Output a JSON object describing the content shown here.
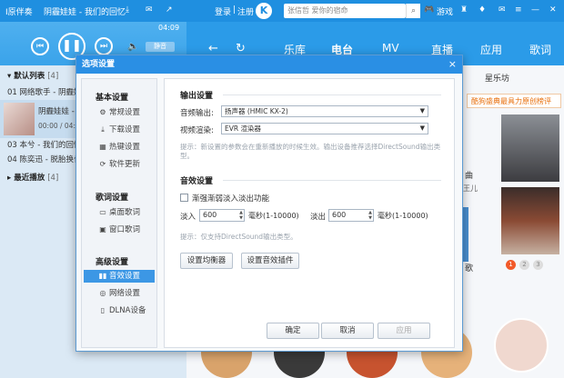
{
  "topbar": {
    "left_title": "I原伴奏",
    "now_playing": "阴霾娃娃 - 我们的回忆",
    "login": "登录",
    "separator": "|",
    "register": "注册",
    "logo_letter": "K",
    "search_placeholder": "张信哲  爱你的宿命",
    "game": "游戏",
    "time": "04:09"
  },
  "player": {
    "volume_label": "静音"
  },
  "nav": {
    "tabs": [
      {
        "label": "乐库"
      },
      {
        "label": "电台"
      },
      {
        "label": "MV"
      },
      {
        "label": "直播"
      },
      {
        "label": "应用"
      },
      {
        "label": "歌词"
      }
    ]
  },
  "playlist": {
    "default_list": "默认列表",
    "default_count": "[4]",
    "songs": [
      {
        "text": "01  网络歌手 - 阴霾娃娃"
      },
      {
        "text": "阴霾娃娃 - 我们的回忆"
      },
      {
        "text": "00:00 / 04:09"
      },
      {
        "text": "03  本兮 - 我们的回忆"
      },
      {
        "text": "04  陈奕迅 - 脱胎换骨"
      }
    ],
    "recent": "最近播放",
    "recent_count": "[4]"
  },
  "right": {
    "tab": "星乐坊",
    "banner": "酷狗盛典最具力原创榜评",
    "frag1": "曲",
    "frag2": "王儿",
    "frag3": "歌",
    "pages": [
      "1",
      "2",
      "3"
    ]
  },
  "dialog": {
    "title": "选项设置",
    "close": "×",
    "sidebar": {
      "basic": "基本设置",
      "basic_items": [
        {
          "label": "常规设置",
          "icon": "gear"
        },
        {
          "label": "下载设置",
          "icon": "download"
        },
        {
          "label": "热键设置",
          "icon": "keyboard"
        },
        {
          "label": "软件更新",
          "icon": "update"
        }
      ],
      "lyrics": "歌词设置",
      "lyrics_items": [
        {
          "label": "桌面歌词",
          "icon": "desktop"
        },
        {
          "label": "窗口歌词",
          "icon": "window"
        }
      ],
      "advanced": "高级设置",
      "advanced_items": [
        {
          "label": "音效设置",
          "icon": "equalizer",
          "active": true
        },
        {
          "label": "网络设置",
          "icon": "globe"
        },
        {
          "label": "DLNA设备",
          "icon": "device"
        }
      ]
    },
    "output": {
      "title": "输出设置",
      "audio_label": "音频输出:",
      "audio_value": "扬声器 (HMIC KX-2)",
      "video_label": "视频渲染:",
      "video_value": "EVR 渲染器",
      "hint": "提示：新设置的参数会在重新播放的时候生效。输出设备推荐选择DirectSound输出类型。"
    },
    "effect": {
      "title": "音效设置",
      "fade_label": "渐强渐弱淡入淡出功能",
      "fadein_label": "淡入",
      "fadein_value": "600",
      "fadeout_label": "淡出",
      "fadeout_value": "600",
      "ms_unit": "毫秒(1-10000)",
      "hint": "提示：仅支持DirectSound输出类型。",
      "eq_button": "设置均衡器",
      "effect_button": "设置音效插件"
    },
    "buttons": {
      "ok": "确定",
      "cancel": "取消",
      "apply": "应用"
    }
  }
}
